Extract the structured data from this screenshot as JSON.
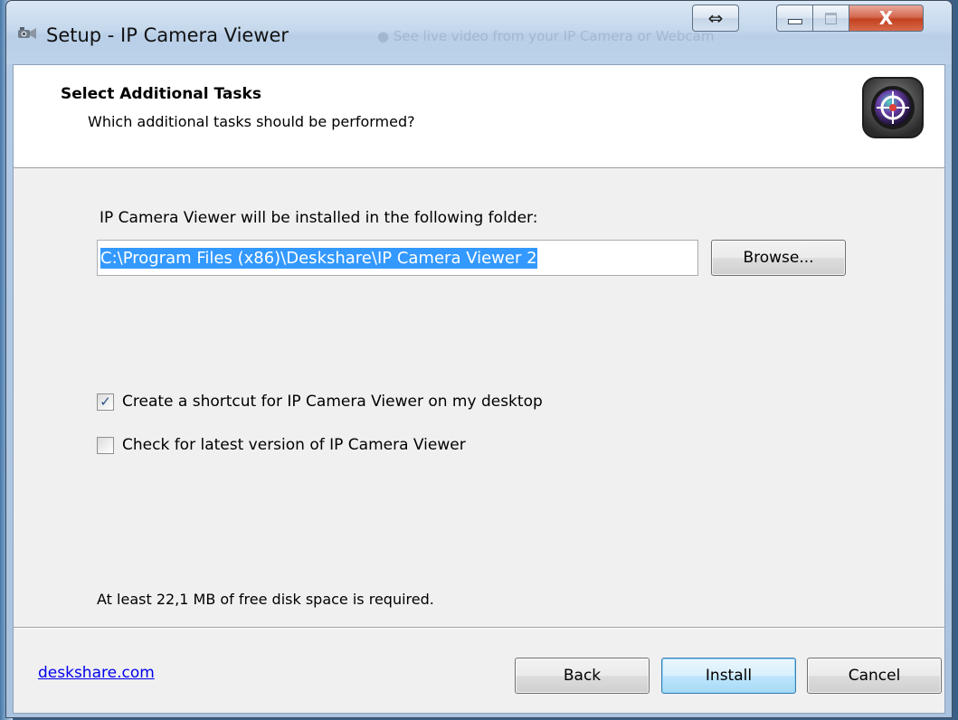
{
  "window": {
    "title": "Setup - IP Camera Viewer",
    "title_ghost": "● See live video from your IP Camera or Webcam"
  },
  "titlebar_buttons": {
    "snap_glyph": "⇔",
    "close_glyph": "X"
  },
  "header": {
    "title": "Select Additional Tasks",
    "subtitle": "Which additional tasks should be performed?",
    "logo_icon": "camera-lens-icon"
  },
  "install_folder": {
    "label": "IP Camera Viewer will be installed in the following folder:",
    "path": "C:\\Program Files (x86)\\Deskshare\\IP Camera Viewer 2",
    "browse_label": "Browse..."
  },
  "tasks": [
    {
      "label": "Create a shortcut for IP Camera Viewer on my desktop",
      "checked": true,
      "mark": "✓"
    },
    {
      "label": "Check for latest version of IP Camera Viewer",
      "checked": false,
      "mark": ""
    }
  ],
  "disk_space_text": "At least 22,1 MB of free disk space is required.",
  "footer": {
    "link": "deskshare.com",
    "back_label": "Back",
    "install_label": "Install",
    "cancel_label": "Cancel"
  },
  "colors": {
    "selection": "#3399ff",
    "link": "#0000ee",
    "close_button": "#c2411f",
    "default_button_border": "#3c7fb1"
  }
}
